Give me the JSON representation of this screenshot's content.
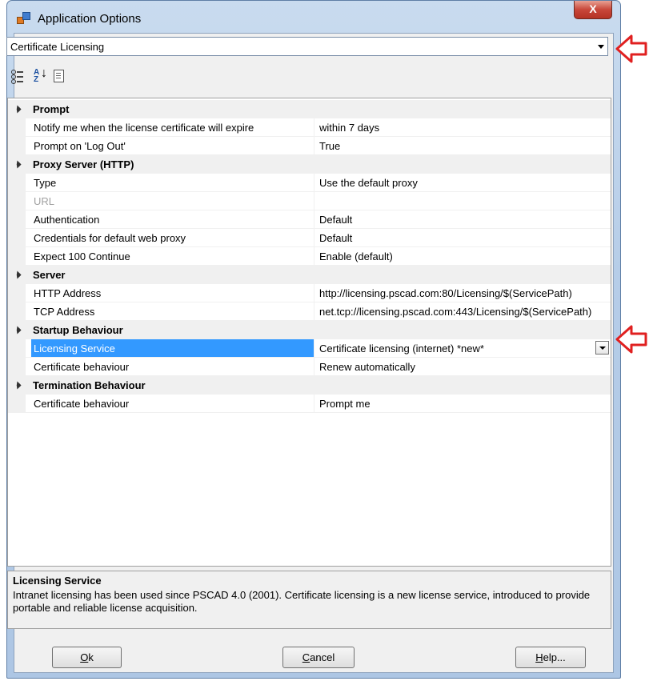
{
  "window": {
    "title": "Application Options",
    "close_label": "X",
    "colors": {
      "selection": "#3399ff",
      "callout": "#e02020",
      "close": "#c8473a"
    }
  },
  "category_select": {
    "value": "Certificate Licensing"
  },
  "toolbar": {
    "icons": [
      "categorized-icon",
      "alphabetical-sort-icon",
      "property-pages-icon"
    ]
  },
  "grid": {
    "categories": [
      {
        "label": "Prompt",
        "rows": [
          {
            "name": "Notify me when the license certificate will expire",
            "value": "within 7 days"
          },
          {
            "name": "Prompt on 'Log Out'",
            "value": "True"
          }
        ]
      },
      {
        "label": "Proxy Server (HTTP)",
        "rows": [
          {
            "name": "Type",
            "value": "Use the default proxy"
          },
          {
            "name": "URL",
            "value": ""
          },
          {
            "name": "Authentication",
            "value": "Default"
          },
          {
            "name": "Credentials for default web proxy",
            "value": "Default"
          },
          {
            "name": "Expect 100 Continue",
            "value": "Enable (default)"
          }
        ]
      },
      {
        "label": "Server",
        "rows": [
          {
            "name": "HTTP Address",
            "value": "http://licensing.pscad.com:80/Licensing/$(ServicePath)"
          },
          {
            "name": "TCP Address",
            "value": "net.tcp://licensing.pscad.com:443/Licensing/$(ServicePath)"
          }
        ]
      },
      {
        "label": "Startup Behaviour",
        "rows": [
          {
            "name": "Licensing Service",
            "value": "Certificate licensing (internet) *new*"
          },
          {
            "name": "Certificate behaviour",
            "value": "Renew automatically"
          }
        ]
      },
      {
        "label": "Termination Behaviour",
        "rows": [
          {
            "name": "Certificate behaviour",
            "value": "Prompt me"
          }
        ]
      }
    ]
  },
  "description": {
    "title": "Licensing Service",
    "text": "Intranet licensing has been used since PSCAD 4.0 (2001). Certificate licensing is a new license service, introduced to provide portable and reliable license acquisition."
  },
  "buttons": {
    "ok": {
      "mnemonic": "O",
      "rest": "k"
    },
    "cancel": {
      "mnemonic": "C",
      "rest": "ancel"
    },
    "help": {
      "mnemonic": "H",
      "rest": "elp..."
    }
  }
}
